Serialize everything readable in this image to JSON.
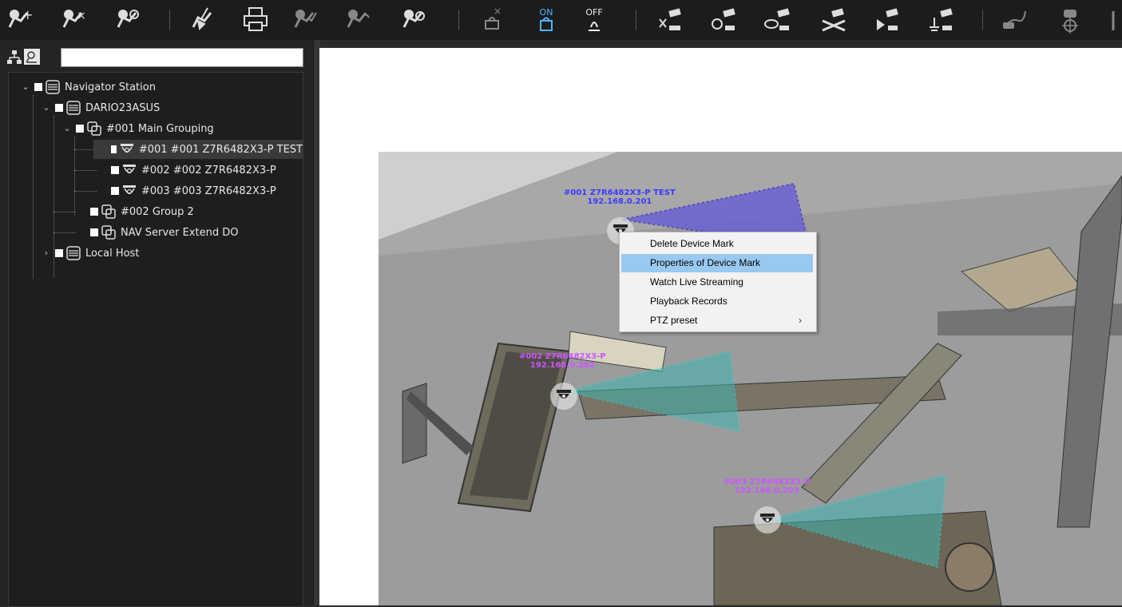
{
  "toolbar": {
    "buttons": [
      {
        "name": "add-device-mark",
        "icon": "map-pin-plus-icon"
      },
      {
        "name": "remove-device-mark",
        "icon": "map-pin-x-icon"
      },
      {
        "name": "device-mark-settings",
        "icon": "map-pin-gear-icon"
      },
      {
        "name": "clear-map",
        "icon": "map-broom-icon"
      },
      {
        "name": "print-map",
        "icon": "printer-icon"
      },
      {
        "name": "check-map",
        "icon": "map-check-icon"
      },
      {
        "name": "undo-map",
        "icon": "map-undo-icon"
      },
      {
        "name": "refresh-map",
        "icon": "map-refresh-icon"
      },
      {
        "name": "alarm-reset",
        "icon": "alarm-reset-icon"
      },
      {
        "name": "alarm-on",
        "icon": "alarm-on-icon"
      },
      {
        "name": "alarm-off",
        "icon": "alarm-off-icon"
      },
      {
        "name": "camera-close",
        "icon": "camera-close-icon"
      },
      {
        "name": "camera-settings",
        "icon": "camera-gear-icon"
      },
      {
        "name": "camera-view",
        "icon": "camera-eye-icon"
      },
      {
        "name": "camera-disconnect",
        "icon": "camera-disconnect-icon"
      },
      {
        "name": "camera-play",
        "icon": "camera-play-icon"
      },
      {
        "name": "camera-ptz",
        "icon": "camera-ptz-icon"
      },
      {
        "name": "vehicle-route",
        "icon": "car-route-icon"
      },
      {
        "name": "vehicle-target",
        "icon": "car-target-icon"
      }
    ],
    "alarm_on_label": "ON",
    "alarm_off_label": "OFF"
  },
  "search": {
    "placeholder": "",
    "value": ""
  },
  "tree": [
    {
      "label": "Navigator Station",
      "level": 0,
      "icon": "server-icon",
      "expanded": true
    },
    {
      "label": "DARIO23ASUS",
      "level": 1,
      "icon": "server-icon",
      "expanded": true
    },
    {
      "label": "#001 Main Grouping",
      "level": 2,
      "icon": "group-icon",
      "expanded": true
    },
    {
      "label": "#001 #001 Z7R6482X3-P TEST",
      "level": 3,
      "icon": "camera-icon",
      "selected": true
    },
    {
      "label": "#002 #002 Z7R6482X3-P",
      "level": 3,
      "icon": "camera-icon"
    },
    {
      "label": "#003 #003 Z7R6482X3-P",
      "level": 3,
      "icon": "camera-icon"
    },
    {
      "label": "#002 Group 2",
      "level": 2,
      "icon": "group-icon"
    },
    {
      "label": "NAV Server Extend DO",
      "level": 2,
      "icon": "group-icon"
    },
    {
      "label": "Local Host",
      "level": 0,
      "icon": "server-icon",
      "expanded": false
    }
  ],
  "map": {
    "cameras": [
      {
        "name": "#001 Z7R6482X3-P TEST",
        "ip": "192.168.0.201",
        "color": "#3b3bff"
      },
      {
        "name": "#002 Z7R6482X3-P",
        "ip": "192.168.0.202",
        "color": "#cc55ff"
      },
      {
        "name": "#003 Z7R6482X3-P",
        "ip": "192.168.0.203",
        "color": "#cc55ff"
      }
    ]
  },
  "context_menu": {
    "items": [
      {
        "label": "Delete Device Mark"
      },
      {
        "label": "Properties of Device Mark",
        "highlighted": true
      },
      {
        "label": "Watch Live Streaming"
      },
      {
        "label": "Playback Records"
      },
      {
        "label": "PTZ preset",
        "submenu": true,
        "arrow": "›"
      }
    ]
  },
  "colors": {
    "toolbar_bg": "#1c1c1c",
    "panel_bg": "#242424",
    "highlight": "#99c9f0",
    "fov_purple": "#6a62d0",
    "fov_teal": "#3fb5b0"
  }
}
